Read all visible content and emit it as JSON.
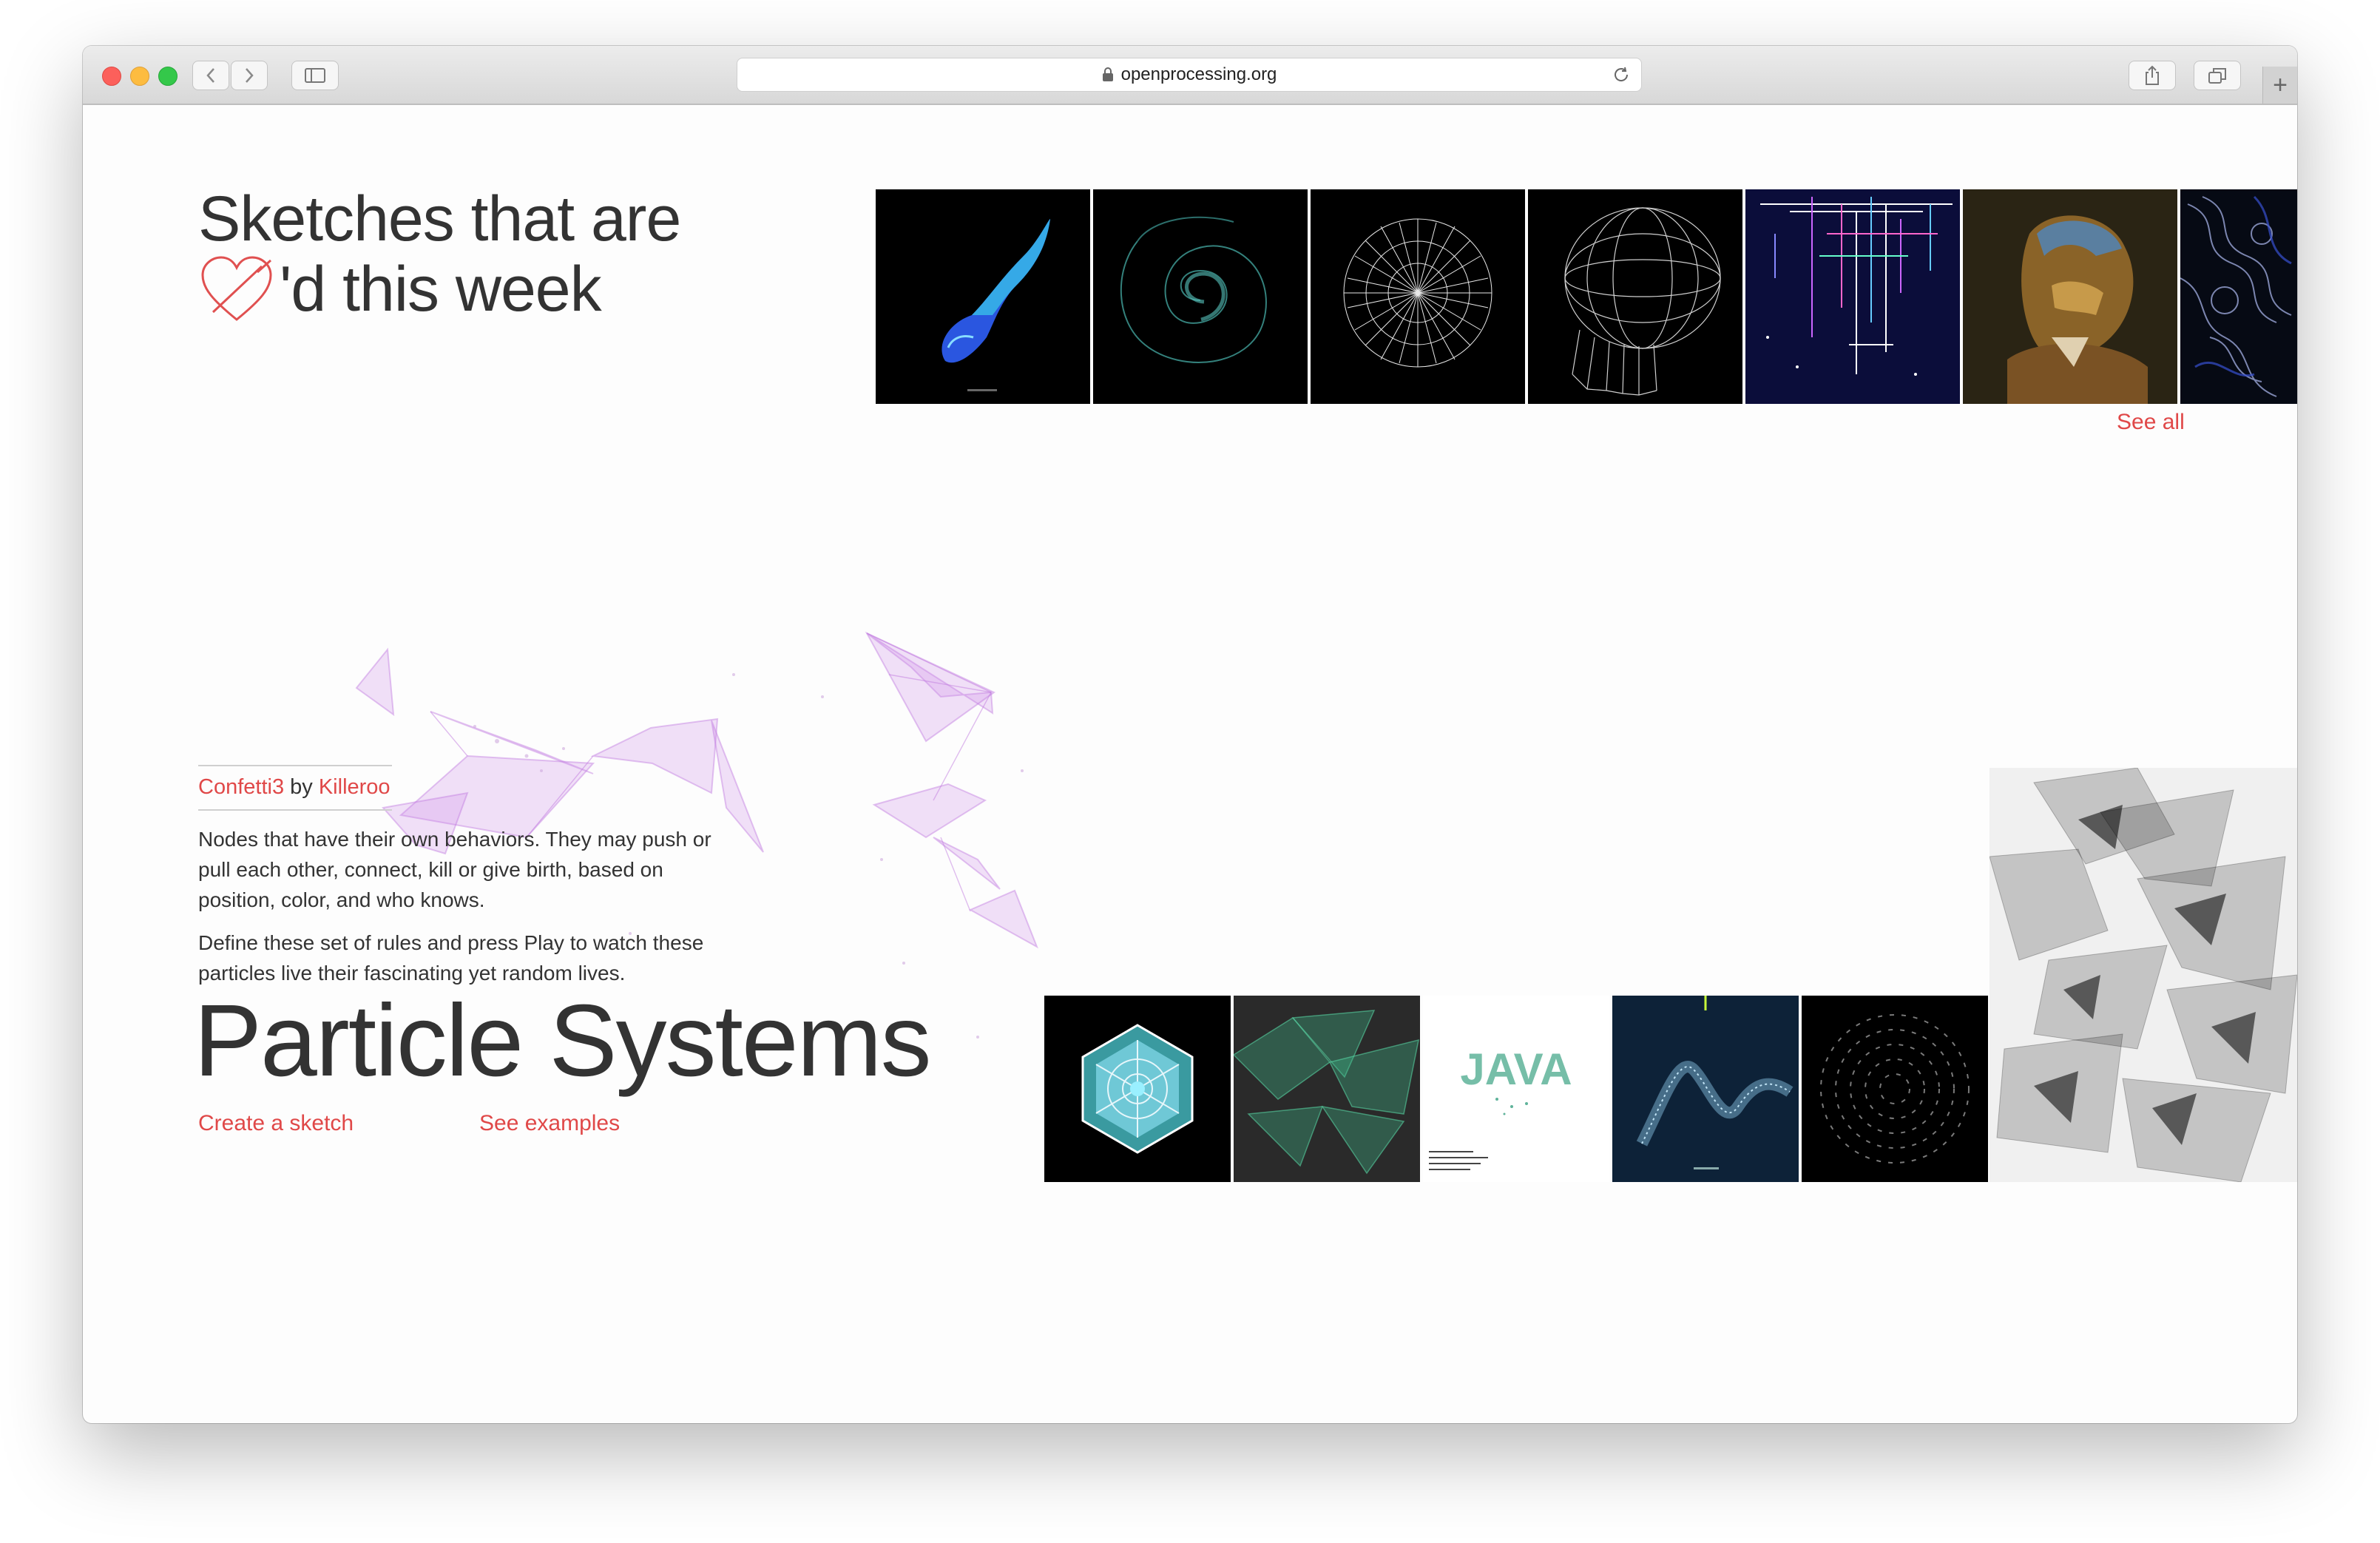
{
  "browser": {
    "url": "openprocessing.org",
    "icons": [
      "back-icon",
      "forward-icon",
      "sidebar-icon",
      "lock-icon",
      "reload-icon",
      "share-icon",
      "tabs-icon",
      "new-tab-icon"
    ],
    "new_tab_label": "+"
  },
  "colors": {
    "accent": "#e04848",
    "text": "#333333",
    "background": "#fdfdfd"
  },
  "hero": {
    "title": "Sketches that are",
    "suffix": "'d this week",
    "heart_icon": "heart-icon",
    "see_all_label": "See all"
  },
  "feature": {
    "sketch_name": "Confetti3",
    "by_label": "by",
    "author": "Killeroo",
    "description": [
      "Nodes that have their own behaviors. They may push or pull each other, connect, kill or give birth, based on position, color, and who knows.",
      "Define these set of rules and press Play to watch these particles live their fascinating yet random lives."
    ],
    "title": "Particle Systems",
    "create_label": "Create a sketch",
    "examples_label": "See examples"
  },
  "thumbs_java_text": "JAVA"
}
